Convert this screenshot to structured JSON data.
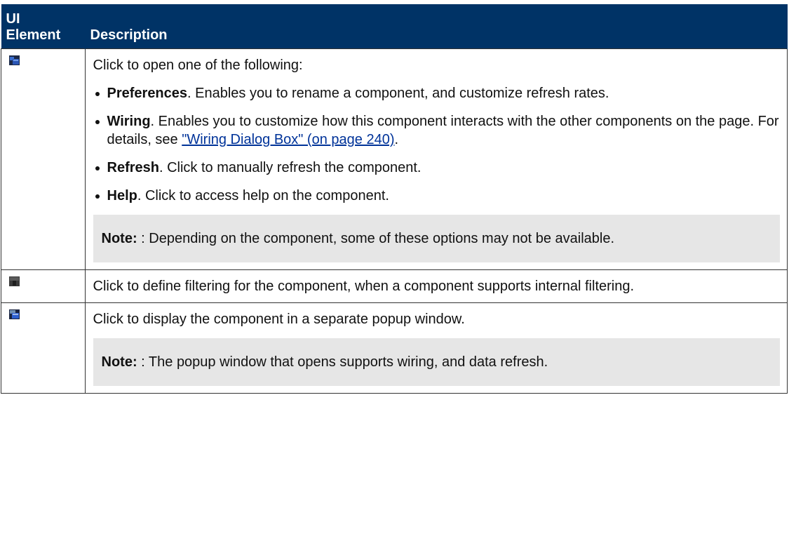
{
  "table": {
    "header": {
      "col_ui": "UI\nElement",
      "col_ui_line1": "UI",
      "col_ui_line2": "Element",
      "col_desc": "Description"
    },
    "rows": [
      {
        "icon": "component-menu-icon",
        "intro": "Click to open one of the following:",
        "bullets": [
          {
            "bold": "Preferences",
            "text": ". Enables you to rename a component, and customize refresh rates."
          },
          {
            "bold": "Wiring",
            "text": ". Enables you to customize how this component interacts with the other components on the page. For details, see ",
            "link": "\"Wiring Dialog Box\" (on page 240)",
            "after": "."
          },
          {
            "bold": "Refresh",
            "text": ". Click to manually refresh the component."
          },
          {
            "bold": "Help",
            "text": ". Click to access help on the component."
          }
        ],
        "note_label": "Note:",
        "note_text": " : Depending on the component, some of these options may not be available."
      },
      {
        "icon": "filter-icon",
        "text": "Click to define filtering for the component, when a component supports internal filtering."
      },
      {
        "icon": "popup-window-icon",
        "text": "Click to display the component in a separate popup window.",
        "note_label": "Note:",
        "note_text": " : The popup window that opens supports wiring, and data refresh."
      }
    ]
  },
  "colors": {
    "header_bg": "#003366",
    "note_bg": "#e6e6e6",
    "link": "#003399"
  }
}
